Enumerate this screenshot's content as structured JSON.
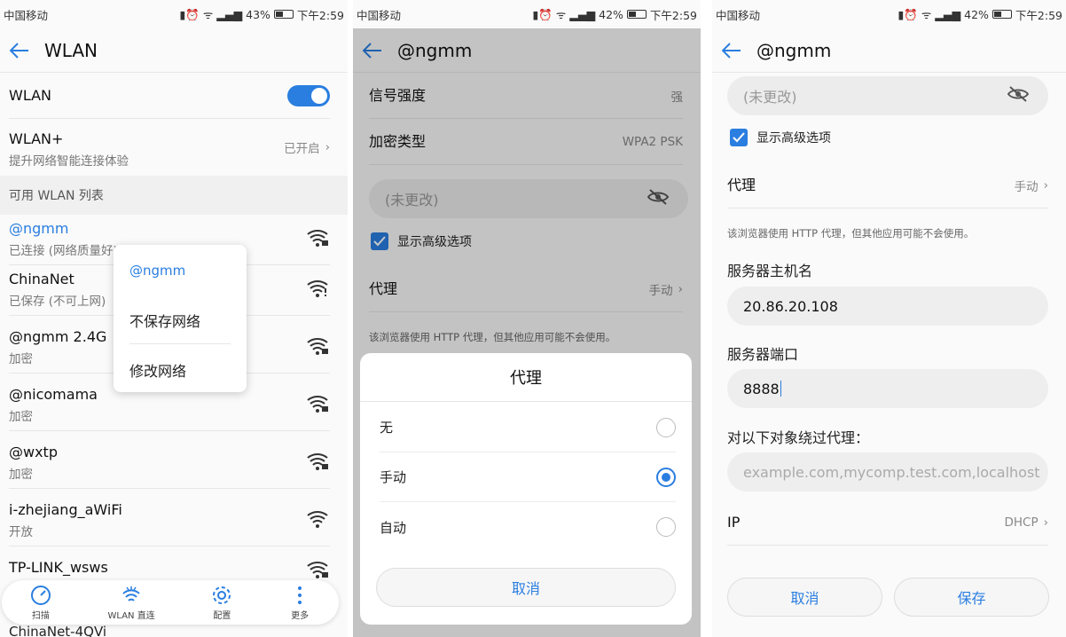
{
  "status": [
    {
      "carrier": "中国移动",
      "battery": "43%",
      "time": "下午2:59"
    },
    {
      "carrier": "中国移动",
      "battery": "42%",
      "time": "下午2:59"
    },
    {
      "carrier": "中国移动",
      "battery": "42%",
      "time": "下午2:59"
    }
  ],
  "accent": "#2a7ee0",
  "p1": {
    "title": "WLAN",
    "wlan_label": "WLAN",
    "wlan_on": true,
    "wlanplus": {
      "label": "WLAN+",
      "sub": "提升网络智能连接体验",
      "value": "已开启"
    },
    "section": "可用 WLAN 列表",
    "networks": [
      {
        "name": "@ngmm",
        "status": "已连接 (网络质量好)",
        "icon": "wifi-lock-icon"
      },
      {
        "name": "ChinaNet",
        "status": "已保存 (不可上网)",
        "icon": "wifi-warn-icon"
      },
      {
        "name": "@ngmm 2.4G",
        "status": "加密",
        "icon": "wifi-lock-icon"
      },
      {
        "name": "@nicomama",
        "status": "加密",
        "icon": "wifi-lock-icon"
      },
      {
        "name": "@wxtp",
        "status": "加密",
        "icon": "wifi-lock-icon"
      },
      {
        "name": "i-zhejiang_aWiFi",
        "status": "开放",
        "icon": "wifi-icon"
      },
      {
        "name": "TP-LINK_wsws",
        "status": "",
        "icon": "wifi-lock-icon"
      }
    ],
    "last_partial": "ChinaNet-4QVi",
    "menu": {
      "title": "@ngmm",
      "forget": "不保存网络",
      "modify": "修改网络"
    },
    "nav": {
      "scan": "扫描",
      "direct": "WLAN 直连",
      "config": "配置",
      "more": "更多"
    }
  },
  "p2": {
    "title": "@ngmm",
    "signal_label": "信号强度",
    "signal_value": "强",
    "enc_label": "加密类型",
    "enc_value": "WPA2 PSK",
    "password_placeholder": "(未更改)",
    "advanced": "显示高级选项",
    "proxy_label": "代理",
    "proxy_value": "手动",
    "note": "该浏览器使用 HTTP 代理，但其他应用可能不会使用。",
    "sheet": {
      "title": "代理",
      "options": [
        "无",
        "手动",
        "自动"
      ],
      "selected": 1,
      "cancel": "取消"
    }
  },
  "p3": {
    "title": "@ngmm",
    "password_placeholder": "(未更改)",
    "advanced": "显示高级选项",
    "proxy_label": "代理",
    "proxy_value": "手动",
    "note": "该浏览器使用 HTTP 代理，但其他应用可能不会使用。",
    "host_label": "服务器主机名",
    "host_value": "20.86.20.108",
    "port_label": "服务器端口",
    "port_value": "8888",
    "bypass_label": "对以下对象绕过代理：",
    "bypass_placeholder": "example.com,mycomp.test.com,localhost",
    "ip_label": "IP",
    "ip_value": "DHCP",
    "cancel": "取消",
    "save": "保存"
  }
}
